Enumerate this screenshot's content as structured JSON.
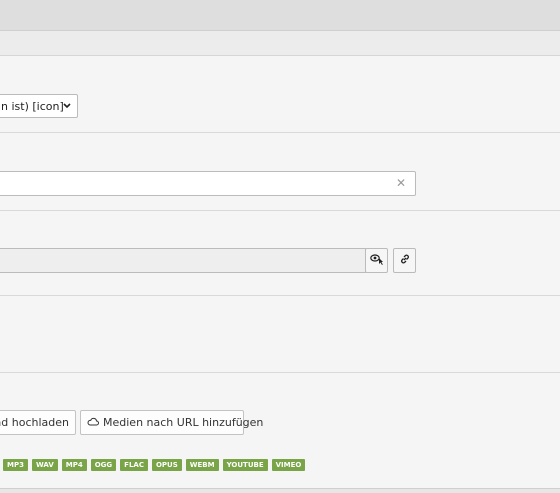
{
  "type_select": {
    "value": "n ist) [icon]"
  },
  "uploader": {
    "upload_button_label": "und hochladen",
    "add_by_url_label": "Medien nach URL hinzufügen"
  },
  "allowed_formats": [
    "MP3",
    "WAV",
    "MP4",
    "OGG",
    "FLAC",
    "OPUS",
    "WEBM",
    "YOUTUBE",
    "VIMEO"
  ],
  "icons": {
    "clear": "close-icon",
    "wizard": "eye-pointer-icon",
    "link": "link-icon",
    "cloud": "cloud-icon",
    "chevron": "chevron-down-icon"
  },
  "colors": {
    "badge": "#79a548"
  }
}
